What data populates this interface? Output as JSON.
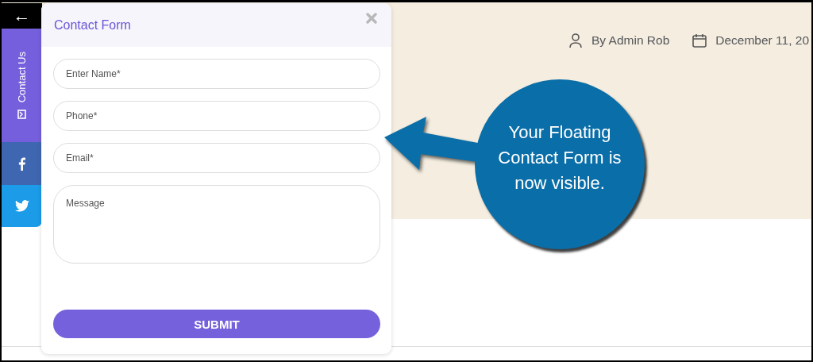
{
  "sidebar": {
    "back": "←",
    "tabs": [
      {
        "kind": "contact",
        "label": "Contact Us"
      },
      {
        "kind": "facebook"
      },
      {
        "kind": "twitter"
      }
    ]
  },
  "form": {
    "title": "Contact Form",
    "fields": [
      {
        "kind": "input",
        "placeholder": "Enter Name*"
      },
      {
        "kind": "input",
        "placeholder": "Phone*"
      },
      {
        "kind": "input",
        "placeholder": "Email*"
      },
      {
        "kind": "textarea",
        "placeholder": "Message"
      }
    ],
    "submit": "SUBMIT"
  },
  "post_meta": {
    "author": "By Admin Rob",
    "date": "December 11, 20"
  },
  "callout": {
    "text": "Your Floating Contact Form is now visible."
  }
}
